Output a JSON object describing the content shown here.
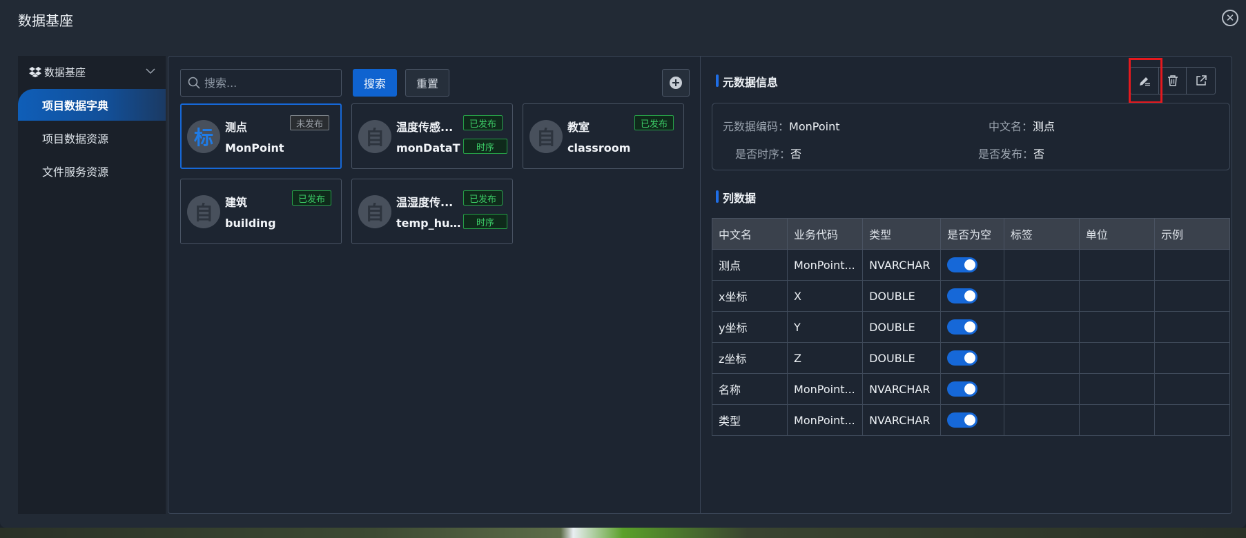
{
  "window": {
    "title": "数据基座",
    "close_icon": "close-circle-icon"
  },
  "sidebar": {
    "header": "数据基座",
    "items": [
      {
        "label": "项目数据字典",
        "active": true
      },
      {
        "label": "项目数据资源",
        "active": false
      },
      {
        "label": "文件服务资源",
        "active": false
      }
    ]
  },
  "toolbar": {
    "search_placeholder": "搜索...",
    "search_label": "搜索",
    "reset_label": "重置",
    "add_icon": "plus-circle-icon"
  },
  "cards": [
    {
      "avatar": "标",
      "name": "测点",
      "code": "MonPoint",
      "status": "未发布",
      "published": false,
      "timeseries": false,
      "selected": true
    },
    {
      "avatar": "自",
      "name": "温度传感...",
      "code": "monDataT",
      "status": "已发布",
      "published": true,
      "timeseries": true,
      "ts_label": "时序",
      "selected": false
    },
    {
      "avatar": "自",
      "name": "教室",
      "code": "classroom",
      "status": "已发布",
      "published": true,
      "timeseries": false,
      "selected": false
    },
    {
      "avatar": "自",
      "name": "建筑",
      "code": "building",
      "status": "已发布",
      "published": true,
      "timeseries": false,
      "selected": false
    },
    {
      "avatar": "自",
      "name": "温湿度传...",
      "code": "temp_hu...",
      "status": "已发布",
      "published": true,
      "timeseries": true,
      "ts_label": "时序",
      "selected": false
    }
  ],
  "metadata": {
    "section_title": "元数据信息",
    "code_label": "元数据编码：",
    "code_value": "MonPoint",
    "cn_label": "中文名：",
    "cn_value": "测点",
    "ts_label": "是否时序：",
    "ts_value": "否",
    "pub_label": "是否发布：",
    "pub_value": "否",
    "actions": [
      "edit-icon",
      "delete-icon",
      "open-external-icon"
    ]
  },
  "columns": {
    "section_title": "列数据",
    "headers": [
      "中文名",
      "业务代码",
      "类型",
      "是否为空",
      "标签",
      "单位",
      "示例"
    ],
    "rows": [
      {
        "cn": "测点",
        "code": "MonPoint...",
        "type": "NVARCHAR",
        "nullable": true,
        "tag": "",
        "unit": "",
        "example": ""
      },
      {
        "cn": "x坐标",
        "code": "X",
        "type": "DOUBLE",
        "nullable": true,
        "tag": "",
        "unit": "",
        "example": ""
      },
      {
        "cn": "y坐标",
        "code": "Y",
        "type": "DOUBLE",
        "nullable": true,
        "tag": "",
        "unit": "",
        "example": ""
      },
      {
        "cn": "z坐标",
        "code": "Z",
        "type": "DOUBLE",
        "nullable": true,
        "tag": "",
        "unit": "",
        "example": ""
      },
      {
        "cn": "名称",
        "code": "MonPoint...",
        "type": "NVARCHAR",
        "nullable": true,
        "tag": "",
        "unit": "",
        "example": ""
      },
      {
        "cn": "类型",
        "code": "MonPoint...",
        "type": "NVARCHAR",
        "nullable": true,
        "tag": "",
        "unit": "",
        "example": ""
      }
    ]
  },
  "colors": {
    "accent": "#0f63d0",
    "published": "#3ccc67",
    "highlight": "#e5191e"
  }
}
